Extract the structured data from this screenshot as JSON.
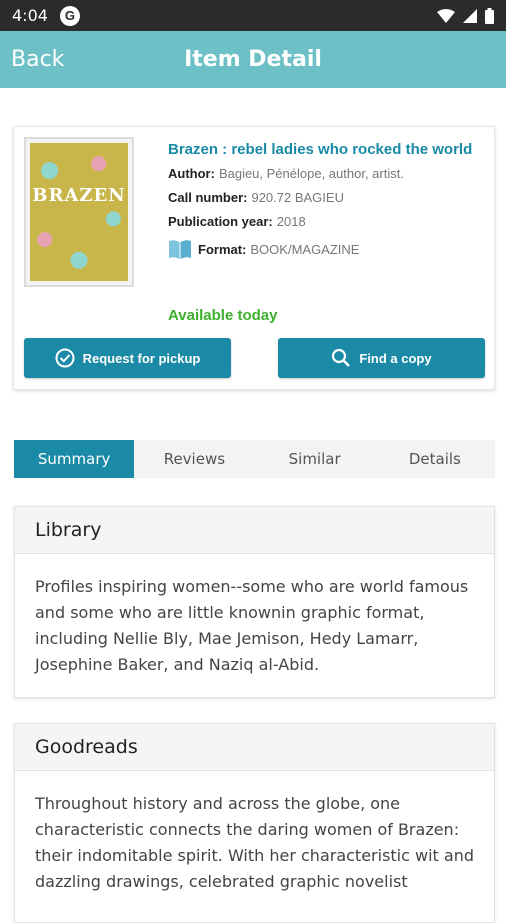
{
  "status": {
    "time": "4:04"
  },
  "appbar": {
    "back": "Back",
    "title": "Item Detail"
  },
  "item": {
    "cover_text": "BRAZEN",
    "title": "Brazen : rebel ladies who rocked the world",
    "author_label": "Author:",
    "author": "Bagieu, Pénélope, author, artist.",
    "call_label": "Call number:",
    "call": "920.72 BAGIEU",
    "year_label": "Publication year:",
    "year": "2018",
    "format_label": "Format:",
    "format": "BOOK/MAGAZINE",
    "availability": "Available today",
    "request_btn": "Request for pickup",
    "find_btn": "Find a copy"
  },
  "tabs": [
    "Summary",
    "Reviews",
    "Similar",
    "Details"
  ],
  "library": {
    "heading": "Library",
    "text": "Profiles inspiring women--some who are world famous and some who are little knownin graphic format, including Nellie Bly, Mae Jemison, Hedy Lamarr, Josephine Baker, and Naziq al-Abid."
  },
  "goodreads": {
    "heading": "Goodreads",
    "text": "Throughout history and across the globe, one characteristic connects the daring women of Brazen: their indomitable spirit. With her characteristic wit and dazzling drawings, celebrated graphic novelist"
  },
  "colors": {
    "appbar": "#6cc0c6",
    "accent": "#1a8aa7",
    "available": "#3cb02c"
  }
}
